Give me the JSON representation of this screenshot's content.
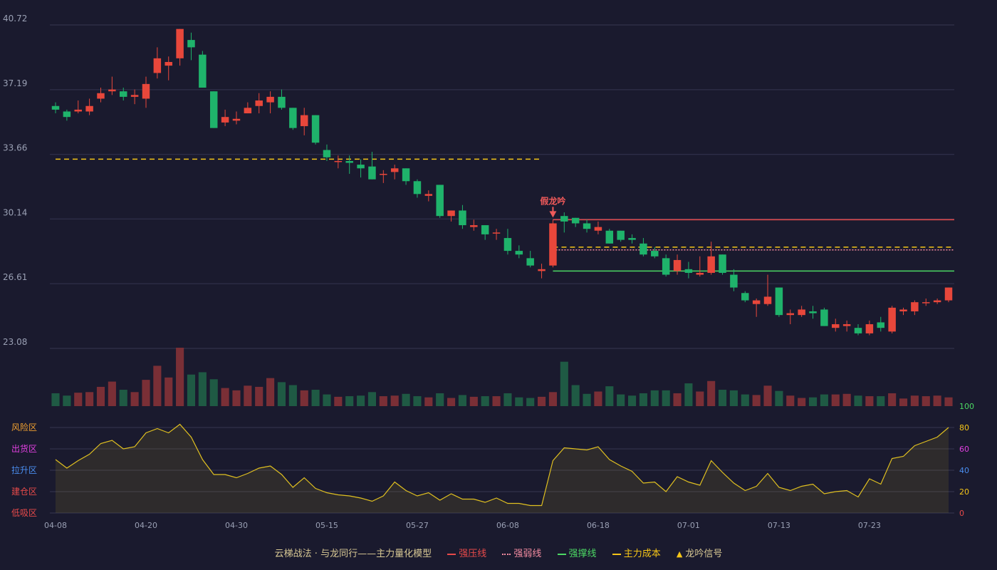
{
  "colors": {
    "background": "#1a1a2e",
    "up": "#e8473b",
    "down": "#1fb36b",
    "up_volume": "#7a2f36",
    "down_volume": "#1f5a44",
    "pressure": "#e84a4a",
    "weak": "#f28ba0",
    "support": "#4cd964",
    "cost": "#f5c518",
    "signal": "#f05a5a",
    "oscillator": "#e0c020",
    "grid": "#353550",
    "text": "#9aa0b4"
  },
  "chart_data": {
    "type": "candlestick",
    "price_axis": {
      "ticks": [
        "40.72",
        "37.19",
        "33.66",
        "30.14",
        "26.61",
        "23.08"
      ]
    },
    "x_ticks": [
      {
        "i": 0,
        "label": "04-08"
      },
      {
        "i": 8,
        "label": "04-20"
      },
      {
        "i": 16,
        "label": "04-30"
      },
      {
        "i": 24,
        "label": "05-15"
      },
      {
        "i": 32,
        "label": "05-27"
      },
      {
        "i": 40,
        "label": "06-08"
      },
      {
        "i": 48,
        "label": "06-18"
      },
      {
        "i": 56,
        "label": "07-01"
      },
      {
        "i": 64,
        "label": "07-13"
      },
      {
        "i": 72,
        "label": "07-23"
      }
    ],
    "candles": [
      [
        36.3,
        36.1,
        36.5,
        35.9
      ],
      [
        36.0,
        35.7,
        36.1,
        35.5
      ],
      [
        36.0,
        36.1,
        36.6,
        35.9
      ],
      [
        36.0,
        36.3,
        36.7,
        35.8
      ],
      [
        36.7,
        37.0,
        37.3,
        36.5
      ],
      [
        37.1,
        37.2,
        37.9,
        36.9
      ],
      [
        37.1,
        36.8,
        37.3,
        36.6
      ],
      [
        36.8,
        36.9,
        37.2,
        36.4
      ],
      [
        36.7,
        37.5,
        37.9,
        36.2
      ],
      [
        38.1,
        38.9,
        39.5,
        37.8
      ],
      [
        38.5,
        38.7,
        39.0,
        37.7
      ],
      [
        38.9,
        40.5,
        40.5,
        38.5
      ],
      [
        39.9,
        39.5,
        40.3,
        38.8
      ],
      [
        39.1,
        37.3,
        39.3,
        37.3
      ],
      [
        37.1,
        35.1,
        37.1,
        35.1
      ],
      [
        35.4,
        35.7,
        36.1,
        35.2
      ],
      [
        35.5,
        35.6,
        36.0,
        35.3
      ],
      [
        35.9,
        36.2,
        36.5,
        35.9
      ],
      [
        36.3,
        36.6,
        37.0,
        35.9
      ],
      [
        36.5,
        36.8,
        37.1,
        35.9
      ],
      [
        36.8,
        36.2,
        37.2,
        36.1
      ],
      [
        36.2,
        35.1,
        36.2,
        35.0
      ],
      [
        35.2,
        35.8,
        36.2,
        34.7
      ],
      [
        35.8,
        34.3,
        35.8,
        34.2
      ],
      [
        33.9,
        33.5,
        34.2,
        33.3
      ],
      [
        33.3,
        33.3,
        33.6,
        32.9
      ],
      [
        33.3,
        33.2,
        33.6,
        32.6
      ],
      [
        33.1,
        32.9,
        33.4,
        32.4
      ],
      [
        33.0,
        32.3,
        33.8,
        32.3
      ],
      [
        32.6,
        32.6,
        32.8,
        32.1
      ],
      [
        32.7,
        32.9,
        33.1,
        32.3
      ],
      [
        32.9,
        32.2,
        32.9,
        32.0
      ],
      [
        32.2,
        31.5,
        32.3,
        31.3
      ],
      [
        31.4,
        31.5,
        31.7,
        31.1
      ],
      [
        32.0,
        30.3,
        32.0,
        30.2
      ],
      [
        30.3,
        30.6,
        30.6,
        30.0
      ],
      [
        30.6,
        29.8,
        30.9,
        29.6
      ],
      [
        29.7,
        29.8,
        30.1,
        29.5
      ],
      [
        29.8,
        29.3,
        29.8,
        29.0
      ],
      [
        29.4,
        29.4,
        29.6,
        29.0
      ],
      [
        29.1,
        28.4,
        29.6,
        28.2
      ],
      [
        28.4,
        28.2,
        28.7,
        28.0
      ],
      [
        28.0,
        27.6,
        28.4,
        27.5
      ],
      [
        27.3,
        27.4,
        27.7,
        26.9
      ],
      [
        27.6,
        29.9,
        30.1,
        27.5
      ],
      [
        30.3,
        30.0,
        30.5,
        29.4
      ],
      [
        30.2,
        29.9,
        30.2,
        29.7
      ],
      [
        29.9,
        29.6,
        30.1,
        29.4
      ],
      [
        29.5,
        29.7,
        30.0,
        29.3
      ],
      [
        29.5,
        28.8,
        29.6,
        28.8
      ],
      [
        29.5,
        29.0,
        29.5,
        28.9
      ],
      [
        29.1,
        29.0,
        29.3,
        28.8
      ],
      [
        28.8,
        28.2,
        29.1,
        28.1
      ],
      [
        28.4,
        28.1,
        28.6,
        28.0
      ],
      [
        28.0,
        27.1,
        28.2,
        27.0
      ],
      [
        27.3,
        27.9,
        28.2,
        27.1
      ],
      [
        27.4,
        27.2,
        27.8,
        26.9
      ],
      [
        27.1,
        27.2,
        28.1,
        27.0
      ],
      [
        27.2,
        28.1,
        28.9,
        27.1
      ],
      [
        28.2,
        27.2,
        28.2,
        27.1
      ],
      [
        27.1,
        26.4,
        27.4,
        26.2
      ],
      [
        26.1,
        25.7,
        26.2,
        25.6
      ],
      [
        25.5,
        25.7,
        25.8,
        24.8
      ],
      [
        25.5,
        25.9,
        27.1,
        25.4
      ],
      [
        26.4,
        24.9,
        26.4,
        24.8
      ],
      [
        24.9,
        25.0,
        25.2,
        24.4
      ],
      [
        24.9,
        25.2,
        25.4,
        24.8
      ],
      [
        25.1,
        25.0,
        25.4,
        24.7
      ],
      [
        25.2,
        24.3,
        25.3,
        24.3
      ],
      [
        24.2,
        24.4,
        24.7,
        24.0
      ],
      [
        24.3,
        24.4,
        24.6,
        24.0
      ],
      [
        24.2,
        23.9,
        24.4,
        23.8
      ],
      [
        23.9,
        24.4,
        24.6,
        23.8
      ],
      [
        24.5,
        24.2,
        24.8,
        24.0
      ],
      [
        24.0,
        25.3,
        25.4,
        23.9
      ],
      [
        25.1,
        25.2,
        25.3,
        24.9
      ],
      [
        25.1,
        25.6,
        25.7,
        24.9
      ],
      [
        25.6,
        25.6,
        25.8,
        25.4
      ],
      [
        25.6,
        25.7,
        25.8,
        25.5
      ],
      [
        25.7,
        26.4,
        26.4,
        25.6
      ]
    ],
    "volumes": [
      0.22,
      0.18,
      0.23,
      0.24,
      0.33,
      0.42,
      0.28,
      0.24,
      0.45,
      0.69,
      0.49,
      1.0,
      0.54,
      0.58,
      0.46,
      0.31,
      0.27,
      0.35,
      0.33,
      0.48,
      0.41,
      0.36,
      0.27,
      0.28,
      0.2,
      0.16,
      0.17,
      0.18,
      0.24,
      0.17,
      0.18,
      0.21,
      0.17,
      0.15,
      0.22,
      0.14,
      0.19,
      0.16,
      0.17,
      0.17,
      0.22,
      0.15,
      0.14,
      0.16,
      0.24,
      0.76,
      0.36,
      0.21,
      0.25,
      0.34,
      0.2,
      0.18,
      0.22,
      0.27,
      0.27,
      0.22,
      0.39,
      0.25,
      0.43,
      0.28,
      0.27,
      0.2,
      0.19,
      0.35,
      0.26,
      0.18,
      0.14,
      0.15,
      0.2,
      0.2,
      0.21,
      0.18,
      0.17,
      0.17,
      0.22,
      0.13,
      0.18,
      0.17,
      0.18,
      0.15
    ],
    "oscillator": {
      "values": [
        50,
        42,
        49,
        55,
        65,
        68,
        60,
        62,
        75,
        79,
        75,
        83,
        71,
        50,
        36,
        36,
        33,
        37,
        42,
        44,
        36,
        24,
        33,
        23,
        19,
        17,
        16,
        14,
        11,
        16,
        29,
        21,
        16,
        19,
        12,
        18,
        13,
        13,
        10,
        14,
        9,
        9,
        7,
        7,
        49,
        61,
        60,
        59,
        62,
        50,
        44,
        39,
        28,
        29,
        20,
        34,
        29,
        26,
        49,
        38,
        28,
        21,
        25,
        37,
        24,
        21,
        25,
        27,
        18,
        20,
        21,
        15,
        32,
        27,
        51,
        53,
        63,
        67,
        71,
        80
      ],
      "axis_ticks": [
        "100",
        "80",
        "60",
        "40",
        "20",
        "0"
      ],
      "zones": [
        "风险区",
        "出货区",
        "拉升区",
        "建仓区",
        "低吸区"
      ],
      "zone_colors": [
        "#f0a030",
        "#e040e0",
        "#4a8ef0",
        "#e84a4a",
        "#e84a4a"
      ]
    },
    "lines": {
      "pressure": {
        "value": 30.1,
        "from_index": 44
      },
      "weak": {
        "value": 28.45,
        "from_index": 44
      },
      "support": {
        "value": 27.3,
        "from_index": 44
      },
      "cost_1": {
        "value": 33.4,
        "from_index": 0,
        "to_index": 43
      },
      "cost_2": {
        "value": 28.6,
        "from_index": 44
      }
    },
    "signal": {
      "index": 44,
      "label": "假龙吟"
    },
    "legend": [
      {
        "key": "title",
        "label": "云梯战法 · 与龙同行——主力量化模型"
      },
      {
        "key": "pressure",
        "label": "强压线"
      },
      {
        "key": "weak",
        "label": "强弱线"
      },
      {
        "key": "support",
        "label": "强撑线"
      },
      {
        "key": "cost",
        "label": "主力成本"
      },
      {
        "key": "signal",
        "label": "龙吟信号"
      }
    ]
  }
}
